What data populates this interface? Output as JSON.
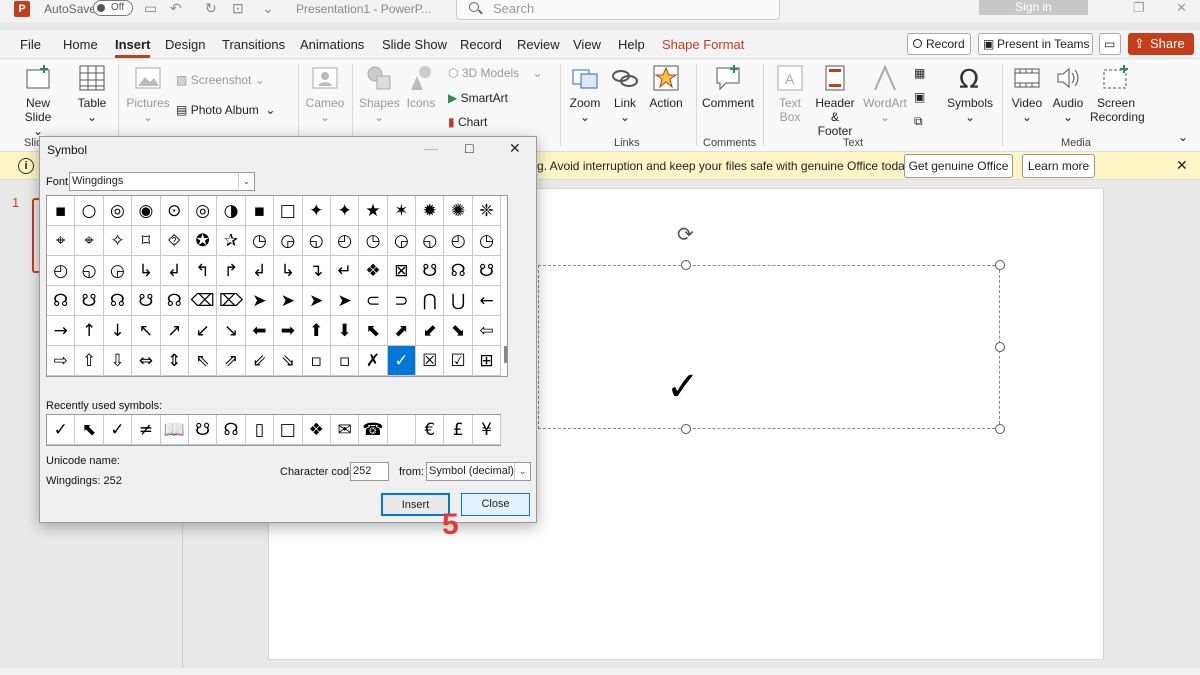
{
  "titlebar": {
    "logo": "P",
    "autosave_label": "AutoSave",
    "autosave_state": "Off",
    "doc_title": "Presentation1 - PowerP...",
    "search_placeholder": "Search",
    "signin": "Sign in"
  },
  "menu": {
    "tabs": [
      "File",
      "Home",
      "Insert",
      "Design",
      "Transitions",
      "Animations",
      "Slide Show",
      "Record",
      "Review",
      "View",
      "Help",
      "Shape Format"
    ],
    "active_tab": "Insert",
    "record_button": "Record",
    "present_button": "Present in Teams",
    "share_button": "Share"
  },
  "ribbon": {
    "new_slide": "New Slide",
    "table": "Table",
    "pictures": "Pictures",
    "screenshot": "Screenshot",
    "photo_album": "Photo Album",
    "cameo": "Cameo",
    "shapes": "Shapes",
    "icons": "Icons",
    "models_3d": "3D Models",
    "smartart": "SmartArt",
    "chart": "Chart",
    "zoom": "Zoom",
    "link": "Link",
    "action": "Action",
    "comment": "Comment",
    "text_box": "Text Box",
    "header_footer": "Header & Footer",
    "wordart": "WordArt",
    "symbols": "Symbols",
    "video": "Video",
    "audio": "Audio",
    "screen_recording": "Screen Recording",
    "group_slides": "Slid",
    "group_links": "Links",
    "group_comments": "Comments",
    "group_text": "Text",
    "group_media": "Media"
  },
  "infobar": {
    "message": "g. Avoid interruption and keep your files safe with genuine Office today.",
    "genuine_button": "Get genuine Office",
    "learn_more_button": "Learn more"
  },
  "slide_panel": {
    "slide_number": "1"
  },
  "slide": {
    "glyph": "✓"
  },
  "dialog": {
    "title": "Symbol",
    "font_label": "Font:",
    "font_value": "Wingdings",
    "symbols": [
      "▪",
      "○",
      "◎",
      "◉",
      "⊙",
      "◎",
      "◑",
      "▪",
      "□",
      "✦",
      "✦",
      "★",
      "✶",
      "✹",
      "✺",
      "❈",
      "⌖",
      "⌖",
      "✧",
      "⌑",
      "⯑",
      "✪",
      "✰",
      "◷",
      "◶",
      "◵",
      "◴",
      "◷",
      "◶",
      "◵",
      "◴",
      "◷",
      "◴",
      "◵",
      "◶",
      "↳",
      "↲",
      "↰",
      "↱",
      "↲",
      "↳",
      "↴",
      "↵",
      "❖",
      "⊠",
      "☋",
      "☊",
      "☋",
      "☊",
      "☋",
      "☊",
      "☋",
      "☊",
      "⌫",
      "⌦",
      "➤",
      "➤",
      "➤",
      "➤",
      "⊂",
      "⊃",
      "⋂",
      "⋃",
      "←",
      "→",
      "↑",
      "↓",
      "↖",
      "↗",
      "↙",
      "↘",
      "⬅",
      "➡",
      "⬆",
      "⬇",
      "⬉",
      "⬈",
      "⬋",
      "⬊",
      "⇦",
      "⇨",
      "⇧",
      "⇩",
      "⇔",
      "⇕",
      "⇖",
      "⇗",
      "⇙",
      "⇘",
      "▫",
      "▫",
      "✗",
      "✓",
      "☒",
      "☑",
      "⊞"
    ],
    "selected_index": 92,
    "recent_label": "Recently used symbols:",
    "recent_symbols": [
      "✓",
      "⬉",
      "✓",
      "≠",
      "📖",
      "☋",
      "☊",
      "▯",
      "□",
      "❖",
      "✉",
      "☎",
      "",
      "€",
      "£",
      "¥"
    ],
    "unicode_name_label": "Unicode name:",
    "unicode_name_value": "Wingdings: 252",
    "char_code_label": "Character code:",
    "char_code_value": "252",
    "from_label": "from:",
    "from_value": "Symbol (decimal)",
    "insert_button": "Insert",
    "close_button": "Close"
  },
  "annotation": {
    "step": "5"
  },
  "colors": {
    "accent": "#c43e1c",
    "selection": "#0078d7",
    "infobar": "#fdf5c3",
    "step": "#e53935"
  }
}
